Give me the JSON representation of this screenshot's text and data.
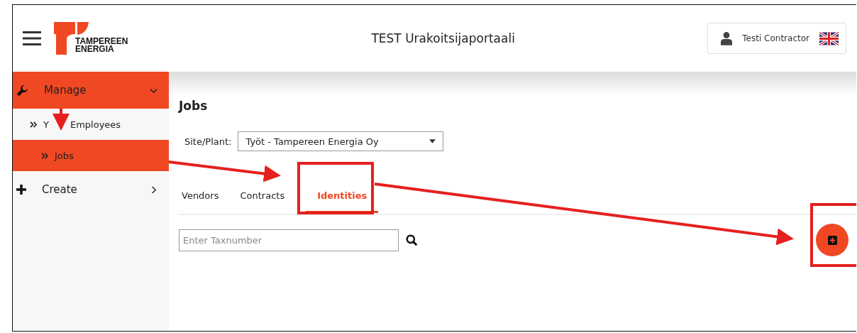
{
  "header": {
    "logo_text": [
      "TAMPEREEN",
      "ENERGIA"
    ],
    "title": "TEST Urakoitsijaportaali",
    "user": "Testi Contractor"
  },
  "sidebar": {
    "items": [
      {
        "label": "Manage",
        "expanded": true,
        "selected": true,
        "children": [
          {
            "label": [
              "Y",
              "Employees"
            ],
            "selected": false
          },
          {
            "label": "Jobs",
            "selected": true
          }
        ]
      },
      {
        "label": "Create",
        "expanded": false,
        "selected": false
      }
    ]
  },
  "page": {
    "title": "Jobs",
    "site_label": "Site/Plant:",
    "site_value": "Työt - Tampereen Energia Oy",
    "tabs": [
      {
        "label": "Vendors",
        "selected": false
      },
      {
        "label": "Contracts",
        "selected": false
      },
      {
        "label": "Identities",
        "selected": true
      }
    ],
    "search": {
      "placeholder": "Enter Taxnumber"
    }
  }
}
